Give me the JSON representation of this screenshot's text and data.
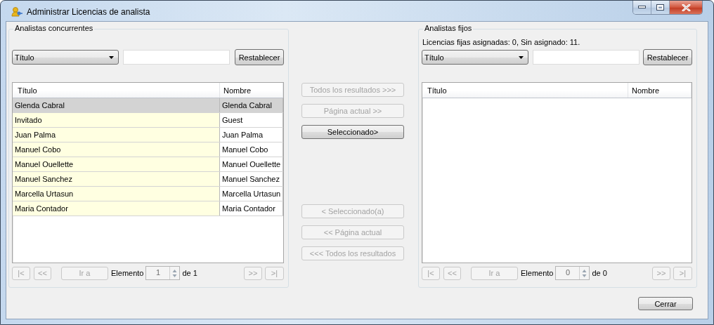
{
  "window": {
    "title": "Administrar Licencias de analista"
  },
  "panels": [
    {
      "title": "Analistas concurrentes",
      "filter": {
        "field": "Título"
      },
      "reset_button": {
        "label": "Restablecer",
        "disabled": false
      },
      "table": {
        "columns": [
          "Título",
          "Nombre"
        ],
        "rows": [
          {
            "cells": [
              "Glenda Cabral",
              "Glenda Cabral"
            ],
            "selected": true
          },
          {
            "cells": [
              "Invitado",
              "Guest"
            ],
            "selected": false
          },
          {
            "cells": [
              "Juan Palma",
              "Juan Palma"
            ],
            "selected": false
          },
          {
            "cells": [
              "Manuel Cobo",
              "Manuel Cobo"
            ],
            "selected": false
          },
          {
            "cells": [
              "Manuel Ouellette",
              "Manuel Ouellette"
            ],
            "selected": false
          },
          {
            "cells": [
              "Manuel Sanchez",
              "Manuel Sanchez"
            ],
            "selected": false
          },
          {
            "cells": [
              "Marcella Urtasun",
              "Marcella Urtasun"
            ],
            "selected": false
          },
          {
            "cells": [
              "Maria Contador",
              "Maria Contador"
            ],
            "selected": false
          }
        ]
      },
      "pager": {
        "first_button": {
          "label": "|<",
          "disabled": true
        },
        "prev_button": {
          "label": "<<",
          "disabled": true
        },
        "goto_button": {
          "label": "Ir a",
          "disabled": true
        },
        "item_label": "Elemento",
        "item_value": "1",
        "total": "de 1",
        "next_button": {
          "label": ">>",
          "disabled": true
        },
        "last_button": {
          "label": ">|",
          "disabled": true
        }
      }
    },
    {
      "title": "Analistas fijos",
      "summary": "Licencias fijas asignadas: 0, Sin asignado: 11.",
      "filter": {
        "field": "Título"
      },
      "reset_button": {
        "label": "Restablecer",
        "disabled": false
      },
      "table": {
        "columns": [
          "Título",
          "Nombre"
        ]
      },
      "pager": {
        "first_button": {
          "label": "|<",
          "disabled": true
        },
        "prev_button": {
          "label": "<<",
          "disabled": true
        },
        "goto_button": {
          "label": "Ir a",
          "disabled": true
        },
        "item_label": "Elemento",
        "item_value": "0",
        "total": "de 0",
        "next_button": {
          "label": ">>",
          "disabled": true
        },
        "last_button": {
          "label": ">|",
          "disabled": true
        }
      }
    }
  ],
  "transfer": {
    "add_buttons": [
      {
        "label": "Todos los resultados >>>",
        "disabled": true
      },
      {
        "label": "Página actual >>",
        "disabled": true
      },
      {
        "label": "Seleccionado>",
        "disabled": false
      }
    ],
    "remove_buttons": [
      {
        "label": "< Seleccionado(a)",
        "disabled": true
      },
      {
        "label": "<< Página actual",
        "disabled": true
      },
      {
        "label": "<<< Todos los resultados",
        "disabled": true
      }
    ]
  },
  "footer": {
    "close_button": {
      "label": "Cerrar",
      "disabled": false
    }
  }
}
